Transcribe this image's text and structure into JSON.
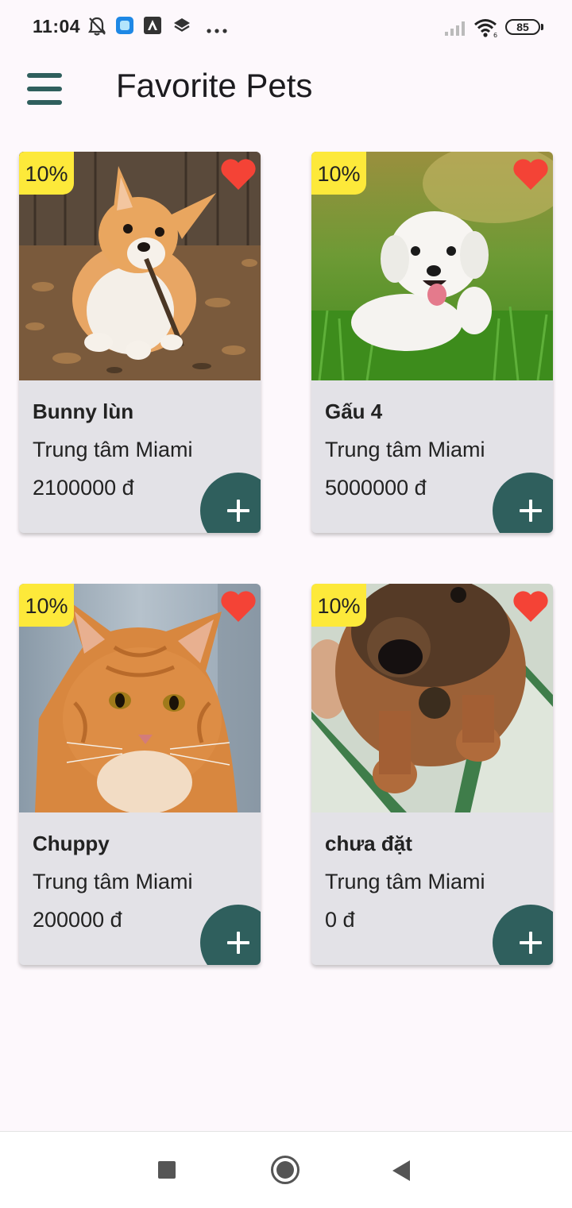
{
  "status_bar": {
    "time": "11:04",
    "battery": "85",
    "left_icons": [
      "notifications-off-icon",
      "app-icon",
      "app-icon",
      "layers-icon",
      "more-icon"
    ],
    "right_icons": [
      "signal-icon",
      "wifi-icon",
      "battery-icon"
    ]
  },
  "app_bar": {
    "title": "Favorite Pets",
    "menu_icon": "menu-icon"
  },
  "colors": {
    "accent": "#2f5f5d",
    "badge": "#fde93a",
    "heart": "#f44336",
    "card_bg": "#e3e2e7",
    "page_bg": "#fdf8fc"
  },
  "pets": [
    {
      "name": "Bunny lùn",
      "location": "Trung tâm Miami",
      "price": "2100000 đ",
      "discount": "10%",
      "favorite": true,
      "photo": "corgi puppy"
    },
    {
      "name": "Gấu 4",
      "location": "Trung tâm Miami",
      "price": "5000000 đ",
      "discount": "10%",
      "favorite": true,
      "photo": "white maltese puppy"
    },
    {
      "name": "Chuppy",
      "location": "Trung tâm Miami",
      "price": "200000 đ",
      "discount": "10%",
      "favorite": true,
      "photo": "orange cat"
    },
    {
      "name": "chưa đặt",
      "location": "Trung tâm Miami",
      "price": "0 đ",
      "discount": "10%",
      "favorite": true,
      "photo": "brown puppy"
    }
  ],
  "nav_bar": {
    "recents_icon": "square-icon",
    "home_icon": "circle-icon",
    "back_icon": "triangle-back-icon"
  }
}
